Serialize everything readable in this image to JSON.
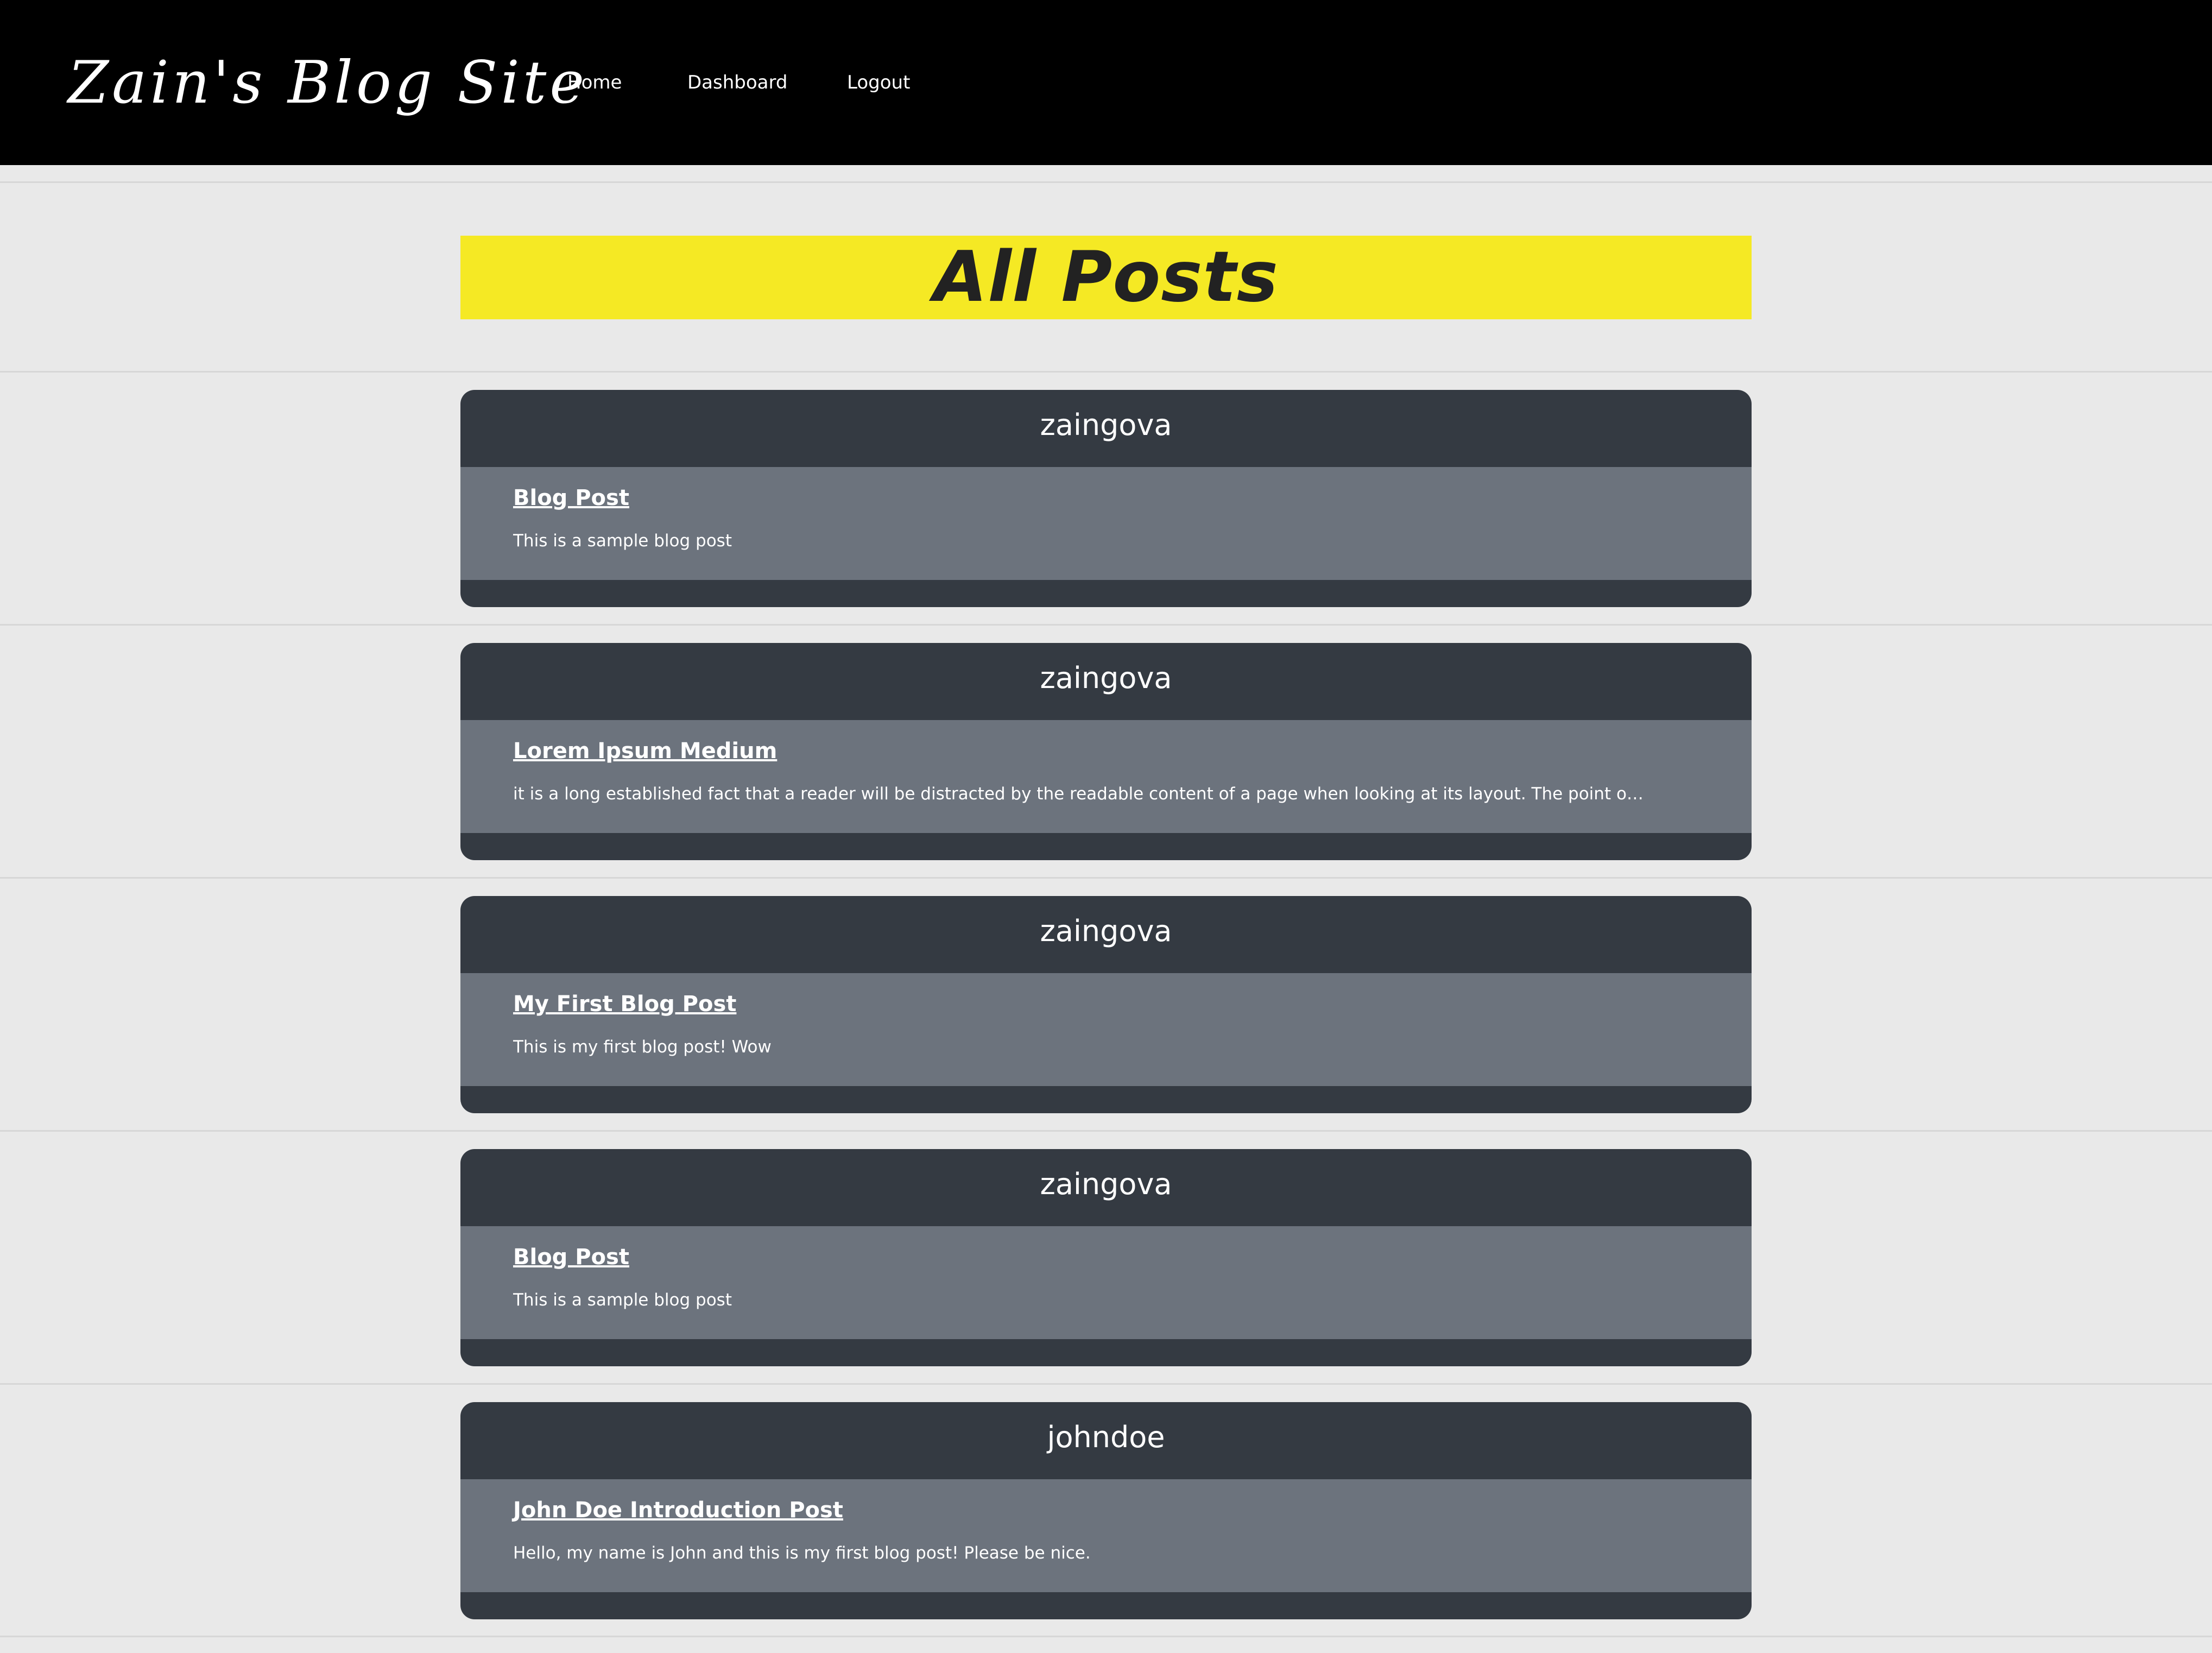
{
  "header": {
    "brand": "Zain's Blog Site",
    "nav": [
      {
        "label": "Home"
      },
      {
        "label": "Dashboard"
      },
      {
        "label": "Logout"
      }
    ]
  },
  "page": {
    "title": "All Posts"
  },
  "posts": [
    {
      "author": "zaingova",
      "title": "Blog Post",
      "excerpt": "This is a sample blog post"
    },
    {
      "author": "zaingova",
      "title": "Lorem Ipsum Medium",
      "excerpt": "it is a long established fact that a reader will be distracted by the readable content of a page when looking at its layout. The point of using Lorem Ipsum is th..."
    },
    {
      "author": "zaingova",
      "title": "My First Blog Post",
      "excerpt": "This is my first blog post! Wow"
    },
    {
      "author": "zaingova",
      "title": "Blog Post",
      "excerpt": "This is a sample blog post"
    },
    {
      "author": "johndoe",
      "title": "John Doe Introduction Post",
      "excerpt": "Hello, my name is John and this is my first blog post! Please be nice."
    }
  ],
  "colors": {
    "navbar_bg": "#000000",
    "page_bg": "#e9e9e9",
    "title_banner": "#f5e924",
    "card_header": "#343a42",
    "card_body": "#6c737d"
  }
}
